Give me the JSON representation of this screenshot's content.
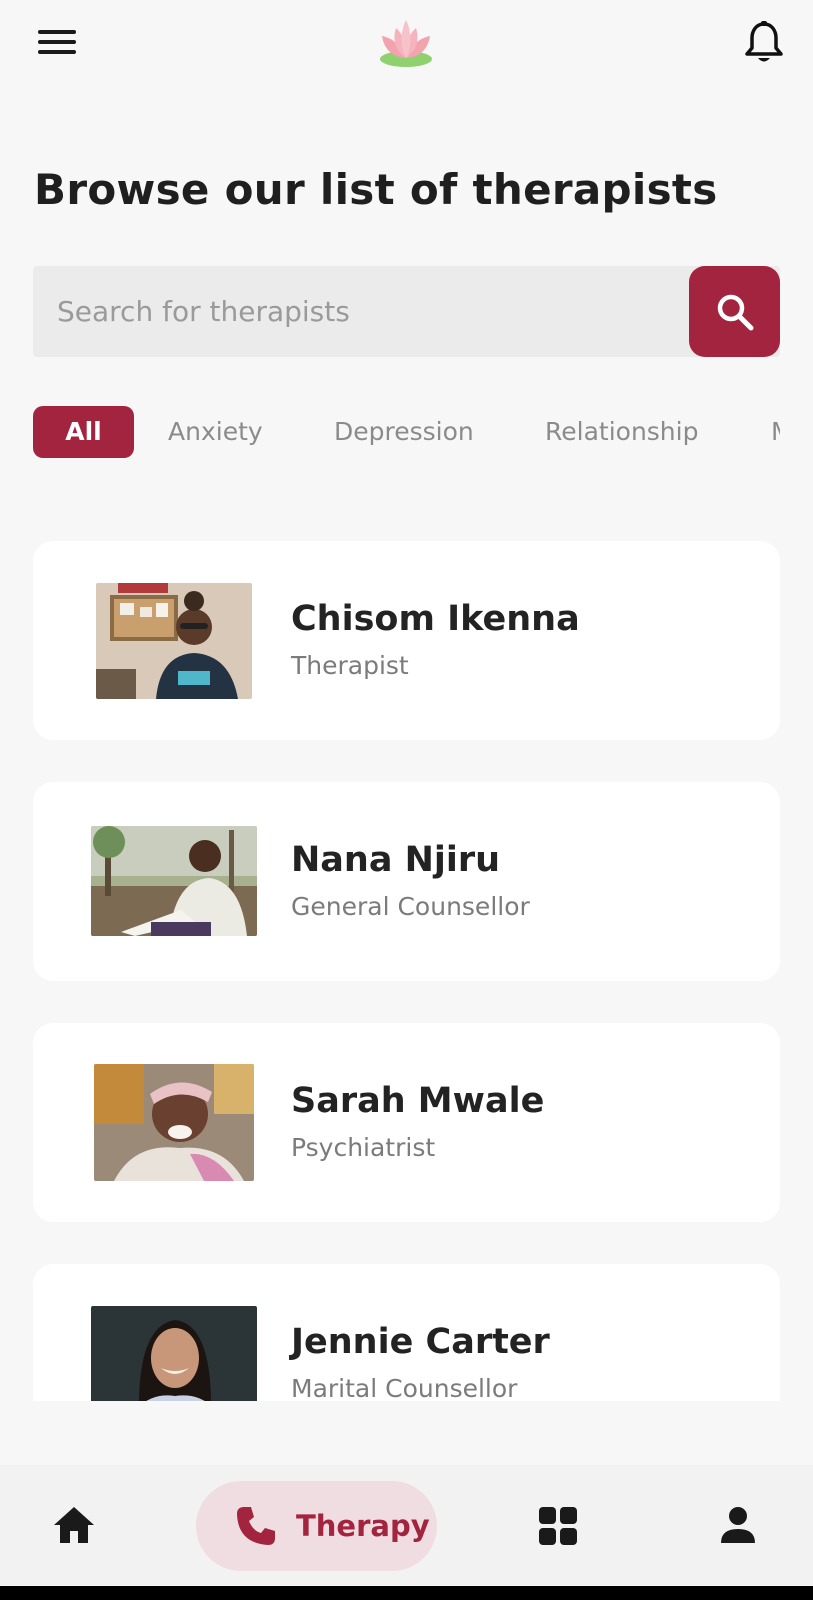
{
  "header": {
    "menu_icon": "hamburger-menu-icon",
    "logo_icon": "lotus-logo-icon",
    "notification_icon": "bell-icon"
  },
  "page": {
    "title": "Browse our list of therapists"
  },
  "search": {
    "placeholder": "Search for therapists",
    "value": "",
    "button_icon": "search-icon"
  },
  "filters": {
    "selected": "All",
    "items": [
      "All",
      "Anxiety",
      "Depression",
      "Relationship",
      "M"
    ]
  },
  "therapists": [
    {
      "name": "Chisom Ikenna",
      "role": "Therapist"
    },
    {
      "name": "Nana Njiru",
      "role": "General Counsellor"
    },
    {
      "name": "Sarah Mwale",
      "role": "Psychiatrist"
    },
    {
      "name": "Jennie Carter",
      "role": "Marital Counsellor"
    }
  ],
  "bottom_nav": {
    "items": [
      {
        "icon": "home-icon",
        "label": ""
      },
      {
        "icon": "phone-icon",
        "label": "Therapy",
        "active": true
      },
      {
        "icon": "apps-grid-icon",
        "label": ""
      },
      {
        "icon": "profile-icon",
        "label": ""
      }
    ]
  },
  "colors": {
    "accent": "#a3243f",
    "accent_soft": "#f0dde1",
    "background": "#f7f7f7",
    "card": "#ffffff",
    "search_bg": "#ebebeb"
  }
}
